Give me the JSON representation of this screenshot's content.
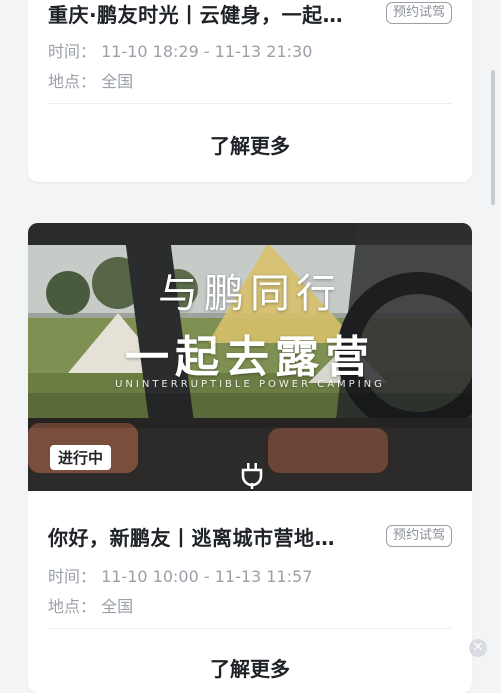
{
  "events": [
    {
      "title": "重庆·鹏友时光丨云健身，一起…",
      "tag": "预约试驾",
      "time": "时间：  11-10 18:29 - 11-13 21:30",
      "location": "地点：  全国",
      "cta": "了解更多"
    },
    {
      "banner": {
        "headline": "与鹏同行",
        "subheadline": "一起去露营",
        "tagline": "UNINTERRUPTIBLE POWER CAMPING",
        "status": "进行中"
      },
      "title": "你好，新鹏友丨逃离城市营地…",
      "tag": "预约试驾",
      "time": "时间：  11-10 10:00 - 11-13 11:57",
      "location": "地点：  全国",
      "cta": "了解更多"
    }
  ],
  "icons": {
    "plug": "plug-icon",
    "close": "close-icon"
  },
  "colors": {
    "background": "#f3f4f6",
    "card": "#ffffff",
    "muted_text": "#9aa0a8"
  }
}
